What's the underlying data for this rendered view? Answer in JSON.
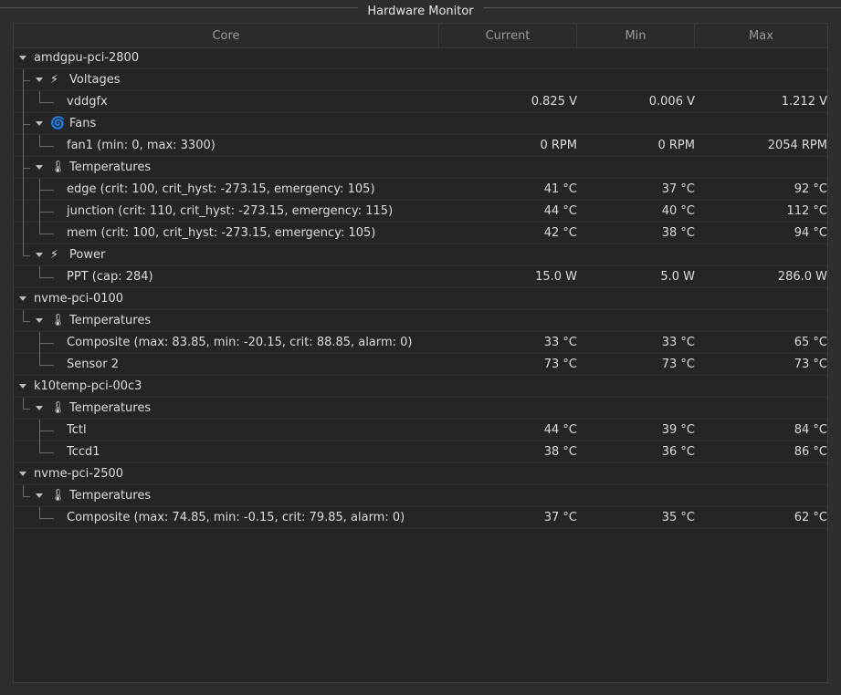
{
  "window": {
    "title": "Hardware Monitor"
  },
  "columns": [
    "Core",
    "Current",
    "Min",
    "Max"
  ],
  "rows": [
    {
      "level": 0,
      "type": "chip",
      "label": "amdgpu-pci-2800"
    },
    {
      "level": 1,
      "type": "group",
      "icon": "⚡",
      "icon_name": "lightning-icon",
      "label": "Voltages"
    },
    {
      "level": 2,
      "type": "sensor",
      "label": "vddgfx",
      "current": "0.825 V",
      "min": "0.006 V",
      "max": "1.212 V"
    },
    {
      "level": 1,
      "type": "group",
      "icon": "🌀",
      "icon_name": "fan-icon",
      "label": "Fans"
    },
    {
      "level": 2,
      "type": "sensor",
      "label": "fan1 (min: 0, max: 3300)",
      "current": "0 RPM",
      "min": "0 RPM",
      "max": "2054 RPM"
    },
    {
      "level": 1,
      "type": "group",
      "icon": "🌡",
      "icon_name": "thermometer-icon",
      "label": "Temperatures"
    },
    {
      "level": 2,
      "type": "sensor",
      "label": "edge (crit: 100, crit_hyst: -273.15, emergency: 105)",
      "current": "41 °C",
      "min": "37 °C",
      "max": "92 °C"
    },
    {
      "level": 2,
      "type": "sensor",
      "label": "junction (crit: 110, crit_hyst: -273.15, emergency: 115)",
      "current": "44 °C",
      "min": "40 °C",
      "max": "112 °C"
    },
    {
      "level": 2,
      "type": "sensor",
      "label": "mem (crit: 100, crit_hyst: -273.15, emergency: 105)",
      "current": "42 °C",
      "min": "38 °C",
      "max": "94 °C"
    },
    {
      "level": 1,
      "type": "group",
      "icon": "⚡",
      "icon_name": "lightning-icon",
      "label": "Power"
    },
    {
      "level": 2,
      "type": "sensor",
      "label": "PPT (cap: 284)",
      "current": "15.0 W",
      "min": "5.0 W",
      "max": "286.0 W"
    },
    {
      "level": 0,
      "type": "chip",
      "label": "nvme-pci-0100"
    },
    {
      "level": 1,
      "type": "group",
      "icon": "🌡",
      "icon_name": "thermometer-icon",
      "label": "Temperatures"
    },
    {
      "level": 2,
      "type": "sensor",
      "label": "Composite (max: 83.85, min: -20.15, crit: 88.85, alarm: 0)",
      "current": "33 °C",
      "min": "33 °C",
      "max": "65 °C"
    },
    {
      "level": 2,
      "type": "sensor",
      "label": "Sensor 2",
      "current": "73 °C",
      "min": "73 °C",
      "max": "73 °C"
    },
    {
      "level": 0,
      "type": "chip",
      "label": "k10temp-pci-00c3"
    },
    {
      "level": 1,
      "type": "group",
      "icon": "🌡",
      "icon_name": "thermometer-icon",
      "label": "Temperatures"
    },
    {
      "level": 2,
      "type": "sensor",
      "label": "Tctl",
      "current": "44 °C",
      "min": "39 °C",
      "max": "84 °C"
    },
    {
      "level": 2,
      "type": "sensor",
      "label": "Tccd1",
      "current": "38 °C",
      "min": "36 °C",
      "max": "86 °C"
    },
    {
      "level": 0,
      "type": "chip",
      "label": "nvme-pci-2500"
    },
    {
      "level": 1,
      "type": "group",
      "icon": "🌡",
      "icon_name": "thermometer-icon",
      "label": "Temperatures"
    },
    {
      "level": 2,
      "type": "sensor",
      "label": "Composite (max: 74.85, min: -0.15, crit: 79.85, alarm: 0)",
      "current": "37 °C",
      "min": "35 °C",
      "max": "62 °C"
    }
  ]
}
